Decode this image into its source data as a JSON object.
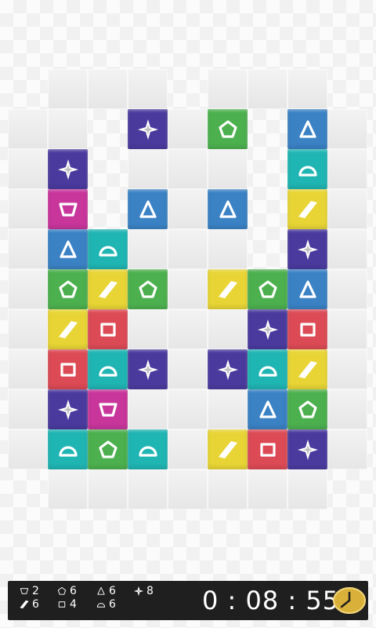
{
  "board": {
    "cols": 9,
    "rows": 11,
    "empty_cells": [
      [
        1,
        0
      ],
      [
        2,
        0
      ],
      [
        3,
        0
      ],
      [
        5,
        0
      ],
      [
        6,
        0
      ],
      [
        7,
        0
      ],
      [
        0,
        1
      ],
      [
        1,
        1
      ],
      [
        4,
        1
      ],
      [
        8,
        1
      ],
      [
        0,
        2
      ],
      [
        3,
        2
      ],
      [
        4,
        2
      ],
      [
        5,
        2
      ],
      [
        8,
        2
      ],
      [
        0,
        3
      ],
      [
        4,
        3
      ],
      [
        8,
        3
      ],
      [
        0,
        4
      ],
      [
        3,
        4
      ],
      [
        4,
        4
      ],
      [
        5,
        4
      ],
      [
        8,
        4
      ],
      [
        0,
        5
      ],
      [
        4,
        5
      ],
      [
        8,
        5
      ],
      [
        0,
        6
      ],
      [
        3,
        6
      ],
      [
        4,
        6
      ],
      [
        5,
        6
      ],
      [
        8,
        6
      ],
      [
        0,
        7
      ],
      [
        4,
        7
      ],
      [
        8,
        7
      ],
      [
        0,
        8
      ],
      [
        3,
        8
      ],
      [
        4,
        8
      ],
      [
        5,
        8
      ],
      [
        8,
        8
      ],
      [
        0,
        9
      ],
      [
        4,
        9
      ],
      [
        8,
        9
      ],
      [
        1,
        10
      ],
      [
        2,
        10
      ],
      [
        3,
        10
      ],
      [
        4,
        10
      ],
      [
        5,
        10
      ],
      [
        6,
        10
      ],
      [
        7,
        10
      ]
    ],
    "tiles": [
      {
        "col": 3,
        "row": 1,
        "shape": "star"
      },
      {
        "col": 5,
        "row": 1,
        "shape": "pentagon"
      },
      {
        "col": 7,
        "row": 1,
        "shape": "triangle"
      },
      {
        "col": 1,
        "row": 2,
        "shape": "star"
      },
      {
        "col": 7,
        "row": 2,
        "shape": "semicircle"
      },
      {
        "col": 1,
        "row": 3,
        "shape": "trapezoid"
      },
      {
        "col": 3,
        "row": 3,
        "shape": "triangle"
      },
      {
        "col": 5,
        "row": 3,
        "shape": "triangle"
      },
      {
        "col": 7,
        "row": 3,
        "shape": "parallelogram"
      },
      {
        "col": 1,
        "row": 4,
        "shape": "triangle"
      },
      {
        "col": 2,
        "row": 4,
        "shape": "semicircle"
      },
      {
        "col": 7,
        "row": 4,
        "shape": "star"
      },
      {
        "col": 1,
        "row": 5,
        "shape": "pentagon"
      },
      {
        "col": 2,
        "row": 5,
        "shape": "parallelogram"
      },
      {
        "col": 3,
        "row": 5,
        "shape": "pentagon"
      },
      {
        "col": 5,
        "row": 5,
        "shape": "parallelogram"
      },
      {
        "col": 6,
        "row": 5,
        "shape": "pentagon"
      },
      {
        "col": 7,
        "row": 5,
        "shape": "triangle"
      },
      {
        "col": 1,
        "row": 6,
        "shape": "parallelogram"
      },
      {
        "col": 2,
        "row": 6,
        "shape": "square"
      },
      {
        "col": 6,
        "row": 6,
        "shape": "star"
      },
      {
        "col": 7,
        "row": 6,
        "shape": "square"
      },
      {
        "col": 1,
        "row": 7,
        "shape": "square"
      },
      {
        "col": 2,
        "row": 7,
        "shape": "semicircle"
      },
      {
        "col": 3,
        "row": 7,
        "shape": "star"
      },
      {
        "col": 5,
        "row": 7,
        "shape": "star"
      },
      {
        "col": 6,
        "row": 7,
        "shape": "semicircle"
      },
      {
        "col": 7,
        "row": 7,
        "shape": "parallelogram"
      },
      {
        "col": 1,
        "row": 8,
        "shape": "star"
      },
      {
        "col": 2,
        "row": 8,
        "shape": "trapezoid"
      },
      {
        "col": 6,
        "row": 8,
        "shape": "triangle"
      },
      {
        "col": 7,
        "row": 8,
        "shape": "pentagon"
      },
      {
        "col": 1,
        "row": 9,
        "shape": "semicircle"
      },
      {
        "col": 2,
        "row": 9,
        "shape": "pentagon"
      },
      {
        "col": 3,
        "row": 9,
        "shape": "semicircle"
      },
      {
        "col": 5,
        "row": 9,
        "shape": "parallelogram"
      },
      {
        "col": 6,
        "row": 9,
        "shape": "square"
      },
      {
        "col": 7,
        "row": 9,
        "shape": "star"
      }
    ]
  },
  "shape_colors": {
    "star": "#4a3a9e",
    "pentagon": "#4cb04e",
    "triangle": "#3a82c4",
    "semicircle": "#1fb5b3",
    "trapezoid": "#c8359b",
    "parallelogram": "#e8d535",
    "square": "#dc4a55"
  },
  "status": {
    "counts": [
      {
        "shape": "trapezoid",
        "value": "2"
      },
      {
        "shape": "pentagon",
        "value": "6"
      },
      {
        "shape": "triangle",
        "value": "6"
      },
      {
        "shape": "star",
        "value": "8"
      },
      {
        "shape": "parallelogram",
        "value": "6"
      },
      {
        "shape": "square",
        "value": "4"
      },
      {
        "shape": "semicircle",
        "value": "6"
      }
    ],
    "timer": "0 : 08 : 55",
    "clock_icon": "clock-icon",
    "clock_color": "#d9b13a"
  }
}
